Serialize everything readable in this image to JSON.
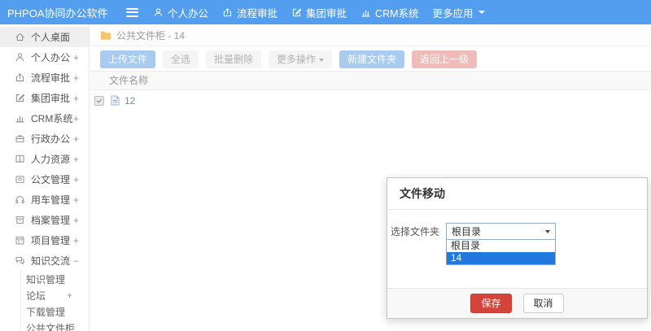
{
  "topbar": {
    "logo": "PHPOA协同办公软件",
    "nav": [
      {
        "label": "个人办公",
        "icon": "user-icon"
      },
      {
        "label": "流程审批",
        "icon": "upload-icon"
      },
      {
        "label": "集团审批",
        "icon": "edit-icon"
      },
      {
        "label": "CRM系统",
        "icon": "bar-chart-icon"
      },
      {
        "label": "更多应用",
        "icon": "caret-down-icon"
      }
    ]
  },
  "sidebar": {
    "items": [
      {
        "label": "个人桌面",
        "active": true
      },
      {
        "label": "个人办公",
        "expand": "+"
      },
      {
        "label": "流程审批",
        "expand": "+"
      },
      {
        "label": "集团审批",
        "expand": "+"
      },
      {
        "label": "CRM系统",
        "expand": "+"
      },
      {
        "label": "行政办公",
        "expand": "+"
      },
      {
        "label": "人力资源",
        "expand": "+"
      },
      {
        "label": "公文管理",
        "expand": "+"
      },
      {
        "label": "用车管理",
        "expand": "+"
      },
      {
        "label": "档案管理",
        "expand": "+"
      },
      {
        "label": "项目管理",
        "expand": "+"
      },
      {
        "label": "知识交流",
        "expand": "−"
      }
    ],
    "submenu": [
      {
        "label": "知识管理",
        "expand": ""
      },
      {
        "label": "论坛",
        "expand": "+"
      },
      {
        "label": "下载管理",
        "expand": ""
      },
      {
        "label": "公共文件柜",
        "expand": ""
      }
    ]
  },
  "breadcrumb": {
    "text": "公共文件柜 - 14"
  },
  "toolbar": {
    "upload": "上传文件",
    "select_all": "全选",
    "batch_delete": "批量删除",
    "more_actions": "更多操作",
    "new_folder": "新建文件夹",
    "back": "返回上一级"
  },
  "table": {
    "header": "文件名称",
    "rows": [
      {
        "name": "12",
        "checked": true
      }
    ]
  },
  "modal": {
    "title": "文件移动",
    "field_label": "选择文件夹",
    "select_value": "根目录",
    "options": [
      {
        "label": "根目录",
        "selected": false
      },
      {
        "label": "14",
        "selected": true
      }
    ],
    "save": "保存",
    "cancel": "取消"
  },
  "colors": {
    "topbar_blue": "#549ef0",
    "option_highlight": "#2179e0",
    "save_red": "#d4443b",
    "folder_yellow": "#f5c76d",
    "light_blue_button": "#a9cbf0",
    "light_red_button": "#efbcba"
  }
}
